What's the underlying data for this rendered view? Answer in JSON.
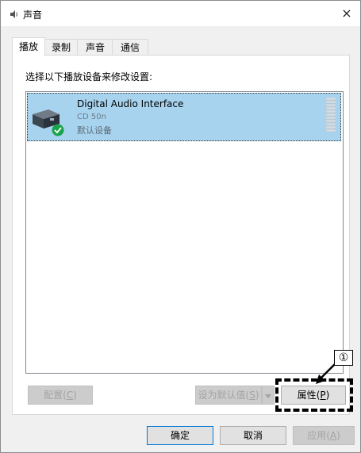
{
  "window": {
    "title": "声音",
    "close_glyph": "×"
  },
  "tabs": [
    {
      "label": "播放",
      "active": true
    },
    {
      "label": "录制",
      "active": false
    },
    {
      "label": "声音",
      "active": false
    },
    {
      "label": "通信",
      "active": false
    }
  ],
  "panel": {
    "instruction": "选择以下播放设备来修改设置:"
  },
  "device": {
    "name": "Digital Audio Interface",
    "model": "CD 50n",
    "status": "默认设备",
    "icon": "audio-device-icon",
    "default_badge_icon": "check-icon",
    "badge_color": "#1aa34a",
    "selected_color": "#a8d3ee"
  },
  "buttons": {
    "configure": {
      "label": "配置",
      "accel": "C"
    },
    "set_default": {
      "label": "设为默认值",
      "accel": "S"
    },
    "properties": {
      "label": "属性",
      "accel": "P"
    },
    "ok": "确定",
    "cancel": "取消",
    "apply": {
      "label": "应用",
      "accel": "A"
    }
  },
  "callout": {
    "number": "①"
  }
}
